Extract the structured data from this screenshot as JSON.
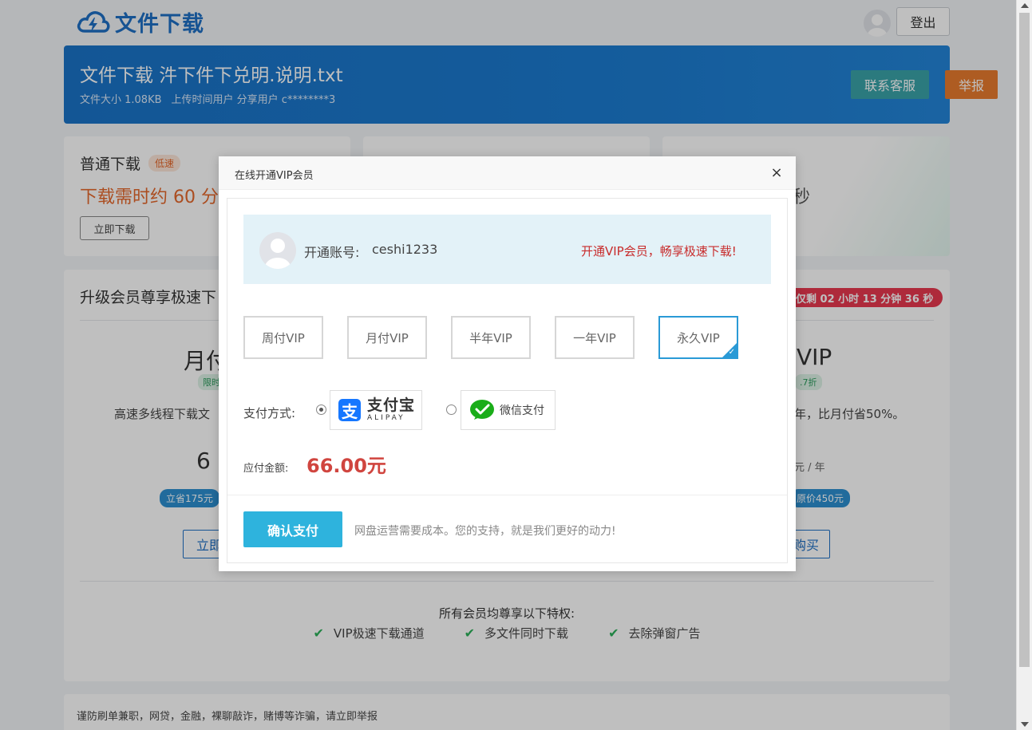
{
  "header": {
    "logo_text": "文件下载",
    "logout_label": "登出"
  },
  "file": {
    "title": "文件下载 汼下件下兑明.说明.txt",
    "size": "文件大小 1.08KB",
    "uploader": "上传时间用户 分享用户 c********3",
    "service_label": "联系客服",
    "report_label": "举报"
  },
  "cards": {
    "normal": {
      "title": "普通下载",
      "tag": "低速",
      "time": "下载需时约 60 分",
      "button": "立即下载"
    },
    "vip": {
      "seconds": "秒"
    }
  },
  "vip_section": {
    "heading": "升级会员尊享极速下",
    "countdown": "仅剩 02 小时 13 分钟 36 秒",
    "left_plan": {
      "name": "月付",
      "tag": "限时",
      "desc": "高速多线程下载文",
      "price": "6",
      "save": "立省175元",
      "button": "立即"
    },
    "right_plan": {
      "name": "VIP",
      "tag": ".7折",
      "desc": "年，比月付省50%。",
      "unit": "元 / 年",
      "orig": "原价450元",
      "button": "购买"
    },
    "privilege_title": "所有会员均尊享以下特权:",
    "privileges": [
      "VIP极速下载通道",
      "多文件同时下载",
      "去除弹窗广告"
    ]
  },
  "footer": {
    "notice": "谨防刷单兼职，网贷，金融，裸聊敲诈，赌博等诈骗，请立即举报"
  },
  "modal": {
    "title": "在线开通VIP会员",
    "close": "×",
    "account_label": "开通账号:",
    "account_name": "ceshi1233",
    "promo": "开通VIP会员，畅享极速下载!",
    "plans": [
      "周付VIP",
      "月付VIP",
      "半年VIP",
      "一年VIP",
      "永久VIP"
    ],
    "selected_plan": "永久VIP",
    "pay_label": "支付方式:",
    "alipay_cn": "支付宝",
    "alipay_en": "ALIPAY",
    "wechat_label": "微信支付",
    "amount_label": "应付金额:",
    "amount_value": "66.00元",
    "confirm_label": "确认支付",
    "confirm_note": "网盘运营需要成本。您的支持，就是我们更好的动力!"
  },
  "colors": {
    "brand": "#1e6fc4",
    "promo_red": "#c82c2c",
    "amount_red": "#d0453f",
    "confirm_blue": "#2eb3dd"
  },
  "icons": {
    "logo": "cloud-bolt-icon",
    "avatar": "user-avatar-icon",
    "close": "close-icon",
    "check": "check-icon",
    "alipay": "alipay-icon",
    "wechat": "wechat-pay-icon"
  }
}
